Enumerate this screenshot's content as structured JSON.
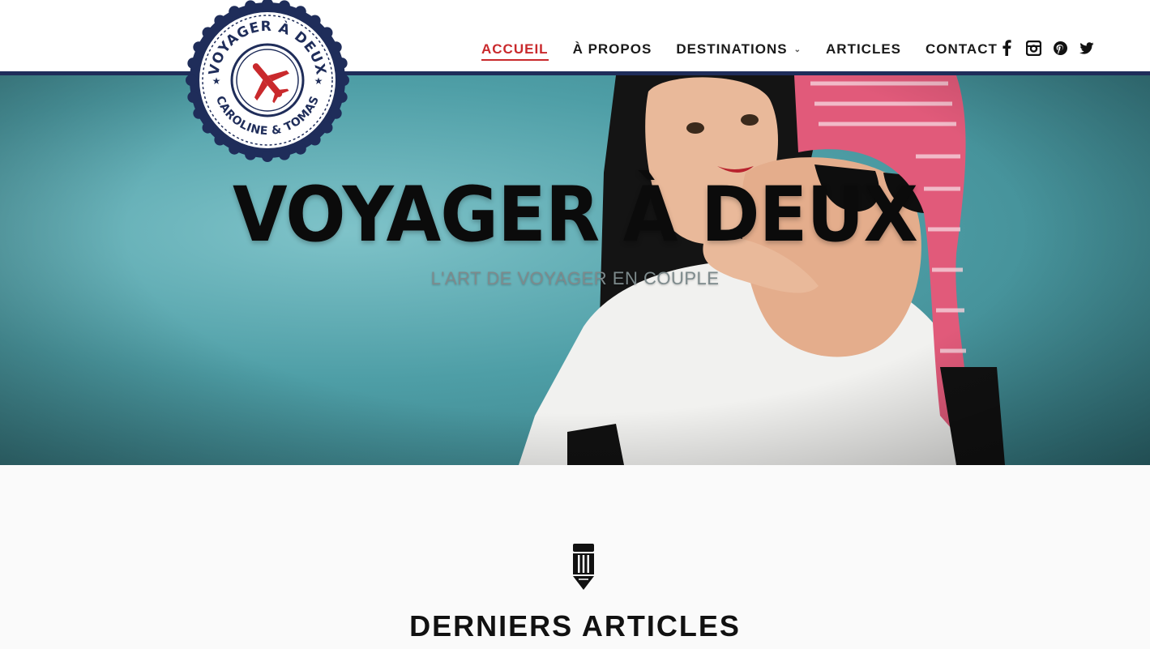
{
  "header": {
    "nav": [
      {
        "label": "ACCUEIL",
        "active": true
      },
      {
        "label": "À PROPOS"
      },
      {
        "label": "DESTINATIONS",
        "has_dropdown": true
      },
      {
        "label": "ARTICLES"
      },
      {
        "label": "CONTACT"
      }
    ],
    "dropdown_glyph": "⌄",
    "social": [
      {
        "name": "facebook-icon"
      },
      {
        "name": "instagram-icon"
      },
      {
        "name": "pinterest-icon"
      },
      {
        "name": "twitter-icon"
      }
    ]
  },
  "logo": {
    "top_text": "VOYAGER À DEUX",
    "bottom_text": "CAROLINE & TOMAS",
    "icon": "airplane-icon"
  },
  "hero": {
    "title": "VOYAGER À DEUX",
    "subtitle": "L'ART DE VOYAGER EN COUPLE"
  },
  "section": {
    "icon": "pencil-icon",
    "title": "DERNIERS ARTICLES"
  },
  "colors": {
    "accent": "#c9292c",
    "navy": "#1f2d5a",
    "hero_bg": "#4e9ea6"
  }
}
